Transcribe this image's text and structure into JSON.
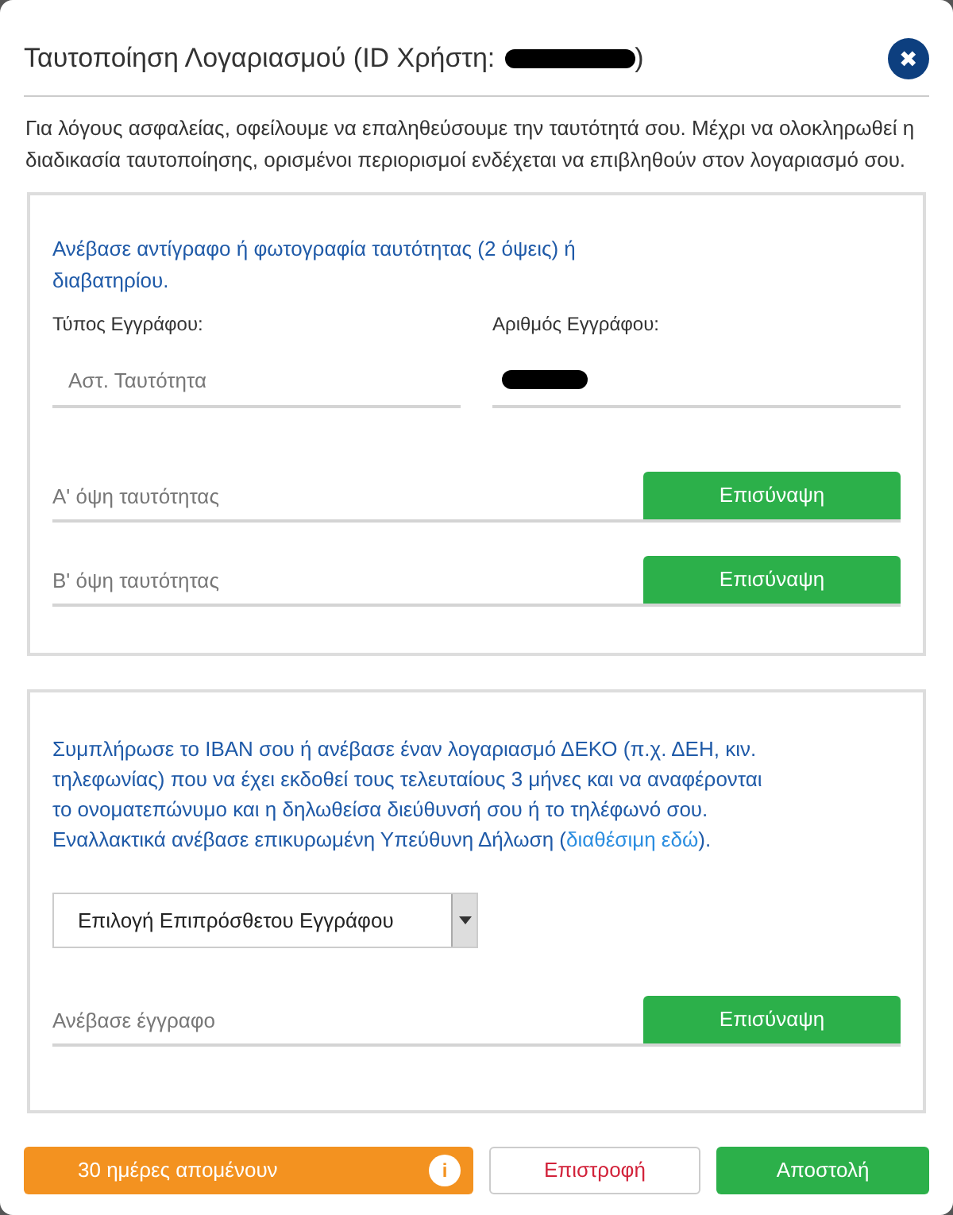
{
  "dialog": {
    "title_start": "Ταυτοποίηση Λογαριασμού (ID Χρήστη:",
    "title_end": ")",
    "close_label": "✖",
    "intro": "Για λόγους ασφαλείας, οφείλουμε να επαληθεύσουμε την ταυτότητά σου. Μέχρι να ολοκληρωθεί η διαδικασία ταυτοποίησης, ορισμένοι περιορισμοί ενδέχεται να επιβληθούν στον λογαριασμό σου."
  },
  "identity_section": {
    "instructions": "Ανέβασε αντίγραφο ή φωτογραφία ταυτότητας (2 όψεις) ή διαβατηρίου.",
    "document_type": {
      "label": "Τύπος Εγγράφου:",
      "placeholder": "Αστ. Ταυτότητα"
    },
    "document_number": {
      "label": "Αριθμός Εγγράφου:"
    },
    "uploads": [
      {
        "placeholder": "Α' όψη ταυτότητας",
        "button": "Επισύναψη"
      },
      {
        "placeholder": "Β' όψη ταυτότητας",
        "button": "Επισύναψη"
      }
    ]
  },
  "address_section": {
    "instructions_before": "Συμπλήρωσε το IBAN σου ή ανέβασε έναν λογαριασμό ΔΕΚΟ (π.χ. ΔΕΗ, κιν. τηλεφωνίας) που να έχει εκδοθεί τους τελευταίους 3 μήνες και να αναφέρονται το ονοματεπώνυμο και η δηλωθείσα διεύθυνσή σου ή το τηλέφωνό σου. Εναλλακτικά ανέβασε επικυρωμένη Υπεύθυνη Δήλωση (",
    "link": "διαθέσιμη εδώ",
    "instructions_after": ").",
    "select": {
      "value": "Επιλογή Επιπρόσθετου Εγγράφου"
    },
    "uploads": [
      {
        "placeholder": "Ανέβασε έγγραφο",
        "button": "Επισύναψη"
      }
    ]
  },
  "footer": {
    "countdown": "30 ημέρες απομένουν",
    "info": "i",
    "back": "Επιστροφή",
    "submit": "Αποστολή"
  }
}
